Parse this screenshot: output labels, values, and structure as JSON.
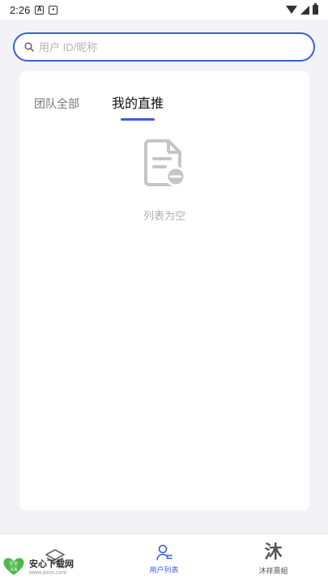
{
  "status_bar": {
    "time": "2:26",
    "notif_icons": [
      "a-icon",
      "card-icon"
    ]
  },
  "search": {
    "placeholder": "用户 ID/昵称",
    "value": ""
  },
  "tabs": [
    {
      "label": "团队全部",
      "active": false
    },
    {
      "label": "我的直推",
      "active": true
    }
  ],
  "empty_state": {
    "icon": "document-minus-icon",
    "text": "列表为空"
  },
  "bottom_nav": [
    {
      "label": "",
      "icon": "layers-icon",
      "active": false
    },
    {
      "label": "用户列表",
      "icon": "user-list-icon",
      "active": true
    },
    {
      "label": "沐祥禀組",
      "icon_char": "沐",
      "active": false
    }
  ],
  "watermark": {
    "badge_top": "安全",
    "badge_bottom": "无毒",
    "main": "安心下载网",
    "sub": "www.axxx.com"
  },
  "colors": {
    "accent": "#3b5ed8",
    "background": "#f3f3f7",
    "card": "#ffffff",
    "muted_text": "#b0b0b5"
  }
}
